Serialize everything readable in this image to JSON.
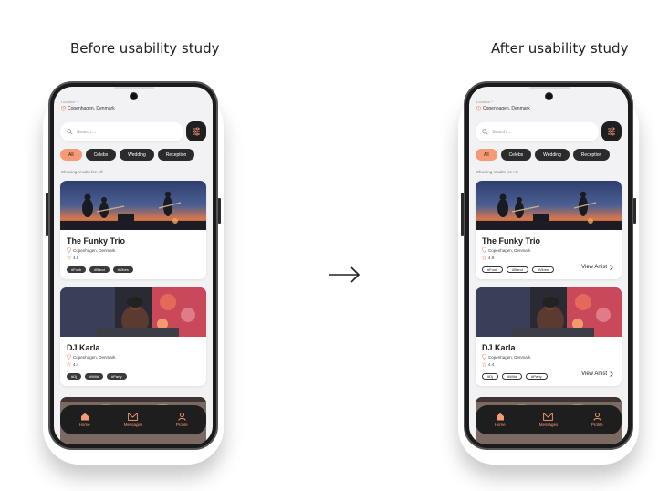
{
  "titles": {
    "before": "Before usability study",
    "after": "After usability study"
  },
  "app": {
    "location_label": "Location ^",
    "location_value": "Copenhagen, Denmark",
    "search_placeholder": "Search ...",
    "chips": [
      "All",
      "Celebs",
      "Wedding",
      "Reception"
    ],
    "showing_results": "Showing results for: All",
    "cards": [
      {
        "name": "The Funky Trio",
        "location": "Copenhagen, Denmark",
        "rating": "4.8",
        "tags": [
          "#Funk",
          "#Band",
          "#Vibes"
        ]
      },
      {
        "name": "DJ Karla",
        "location": "Copenhagen, Denmark",
        "rating": "4.4",
        "tags": [
          "#Dj",
          "#Wild",
          "#Party"
        ]
      }
    ],
    "view_artist": "View Artist",
    "nav": [
      "Home",
      "Messages",
      "Profile"
    ]
  },
  "colors": {
    "accent": "#f59a74",
    "dark": "#1e1e1e",
    "screen_bg": "#f2f2f4"
  }
}
